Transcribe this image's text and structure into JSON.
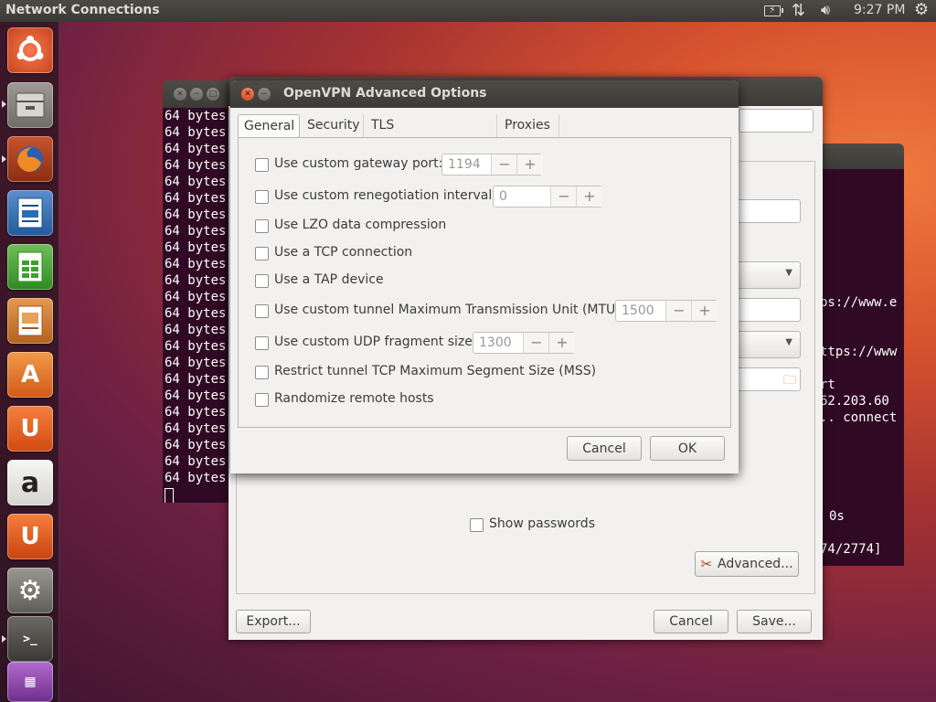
{
  "top_panel": {
    "app_title": "Network Connections",
    "clock": "9:27 PM",
    "indicators": [
      "battery-icon",
      "network-arrows-icon",
      "volume-icon",
      "gear-icon"
    ]
  },
  "launcher": {
    "items": [
      "ubuntu-dash-icon",
      "files-icon",
      "firefox-icon",
      "writer-icon",
      "calc-icon",
      "impress-icon",
      "software-center-icon",
      "ubuntu-one-icon",
      "amazon-icon",
      "ubuntu-one-music-icon",
      "system-settings-icon",
      "terminal-icon",
      "workspace-icon"
    ]
  },
  "terminal_left": {
    "lines": [
      "64 bytes",
      "64 bytes",
      "64 bytes",
      "64 bytes",
      "64 bytes",
      "64 bytes",
      "64 bytes",
      "64 bytes",
      "64 bytes",
      "64 bytes",
      "64 bytes",
      "64 bytes",
      "64 bytes",
      "64 bytes",
      "64 bytes",
      "64 bytes",
      "64 bytes",
      "64 bytes",
      "64 bytes",
      "64 bytes",
      "64 bytes",
      "64 bytes",
      "64 bytes"
    ]
  },
  "terminal_right": {
    "lines": [
      "ps://www.e",
      "ttps://www",
      "rt",
      "62.203.60",
      ".. connect",
      "0s",
      "74/2774]"
    ]
  },
  "main_dialog": {
    "show_passwords": "Show passwords",
    "advanced_button": "Advanced...",
    "export_button": "Export...",
    "cancel_button": "Cancel",
    "save_button": "Save..."
  },
  "advanced_dialog": {
    "title": "OpenVPN Advanced Options",
    "tabs": [
      "General",
      "Security",
      "TLS Authentication",
      "Proxies"
    ],
    "active_tab": "General",
    "options": [
      {
        "label": "Use custom gateway port:",
        "value": "1194",
        "checked": false
      },
      {
        "label": "Use custom renegotiation interval:",
        "value": "0",
        "checked": false
      },
      {
        "label": "Use LZO data compression",
        "checked": false
      },
      {
        "label": "Use a TCP connection",
        "checked": false
      },
      {
        "label": "Use a TAP device",
        "checked": false
      },
      {
        "label": "Use custom tunnel Maximum Transmission Unit (MTU):",
        "value": "1500",
        "checked": false
      },
      {
        "label": "Use custom UDP fragment size:",
        "value": "1300",
        "checked": false
      },
      {
        "label": "Restrict tunnel TCP Maximum Segment Size (MSS)",
        "checked": false
      },
      {
        "label": "Randomize remote hosts",
        "checked": false
      }
    ],
    "spin_minus": "−",
    "spin_plus": "+",
    "cancel_button": "Cancel",
    "ok_button": "OK"
  }
}
